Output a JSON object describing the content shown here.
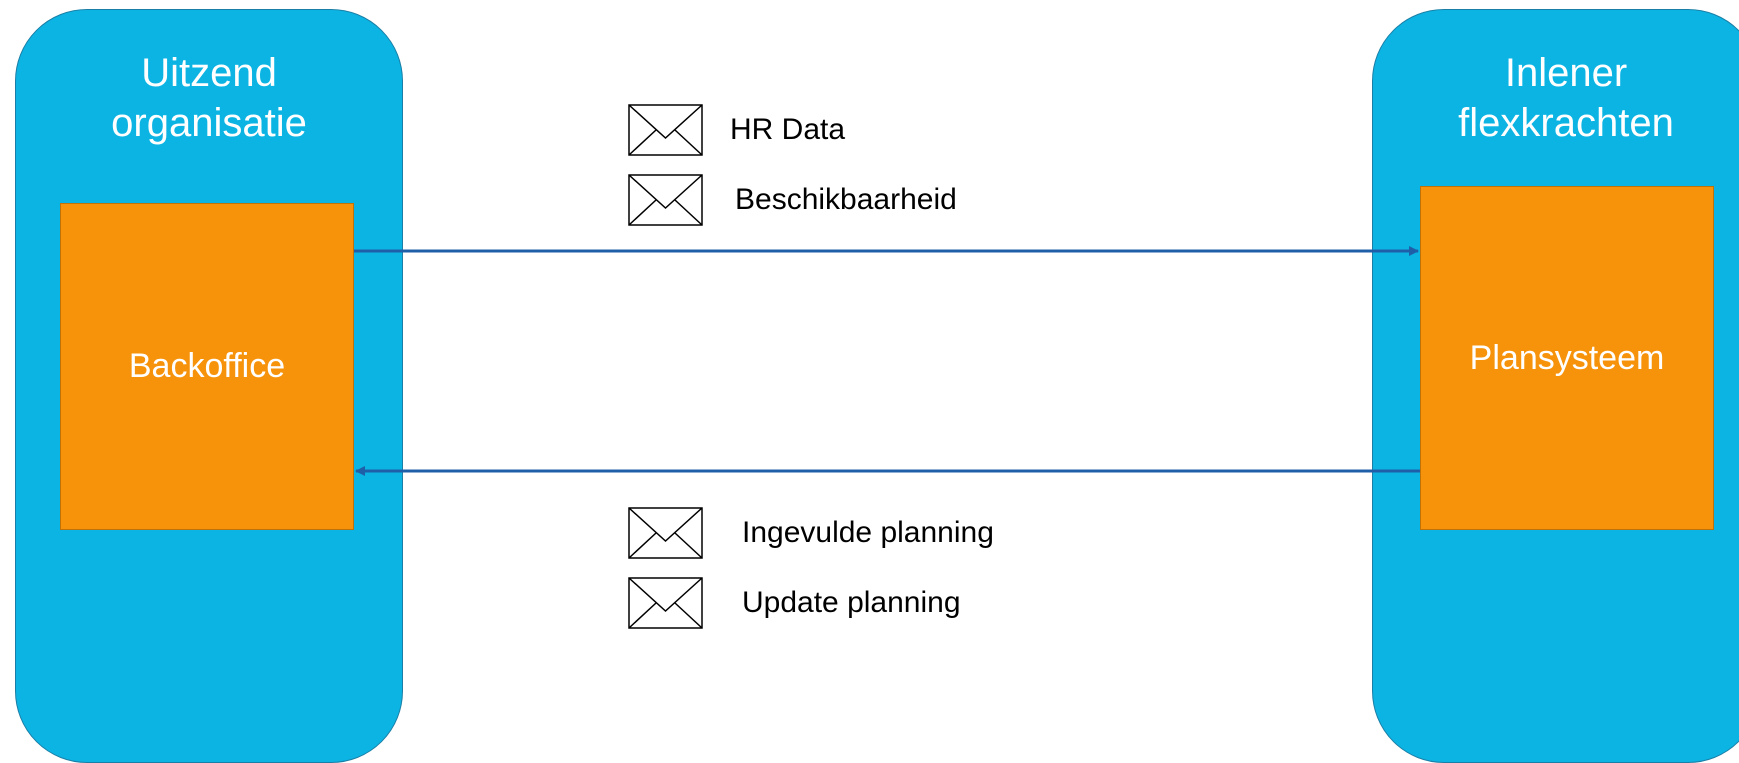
{
  "left_lane": {
    "title": "Uitzend\norganisatie"
  },
  "right_lane": {
    "title": "Inlener\nflexkrachten"
  },
  "left_box": {
    "label": "Backoffice"
  },
  "right_box": {
    "label": "Plansysteem"
  },
  "outgoing_messages": [
    {
      "label": "HR Data",
      "icon": "envelope-icon"
    },
    {
      "label": "Beschikbaarheid",
      "icon": "envelope-icon"
    }
  ],
  "incoming_messages": [
    {
      "label": "Ingevulde planning",
      "icon": "envelope-icon"
    },
    {
      "label": "Update planning",
      "icon": "envelope-icon"
    }
  ],
  "colors": {
    "lane": "#0cb4e4",
    "box": "#f7930a",
    "arrow": "#1f5fa8"
  }
}
